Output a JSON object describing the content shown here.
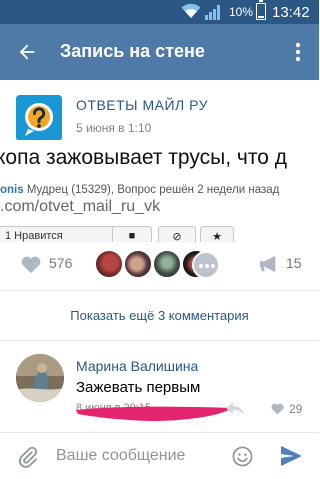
{
  "status_bar": {
    "battery_percent": "10%",
    "time": "13:42",
    "icons": [
      "wifi-icon",
      "signal-icon",
      "battery-icon"
    ]
  },
  "toolbar": {
    "title": "Запись на стене",
    "back_icon": "arrow-left-icon",
    "more_icon": "more-vertical-icon"
  },
  "post": {
    "author": "ОТВЕТЫ МАЙЛ РУ",
    "date": "5 июня в 1:10",
    "image": {
      "question_text": "копа зажовывает трусы, что д",
      "meta_name": "onis",
      "meta_rest": " Мудрец (15329), Вопрос решён 2 недели назад",
      "url_text": ".com/otvet_mail_ru_vk",
      "like_button_label": "1 Нравится"
    }
  },
  "actions": {
    "like_count": "576",
    "share_count": "15"
  },
  "show_more_label": "Показать ещё 3 комментария",
  "comment": {
    "author": "Марина Валишина",
    "text": "Зажевать первым",
    "date": "8 июня в 20:15",
    "like_count": "29"
  },
  "composer": {
    "placeholder": "Ваше сообщение"
  },
  "colors": {
    "status_bar": "#2c5785",
    "toolbar": "#4f7aa8",
    "link": "#2a5885",
    "marker": "#e5246e",
    "send": "#5181b8"
  }
}
